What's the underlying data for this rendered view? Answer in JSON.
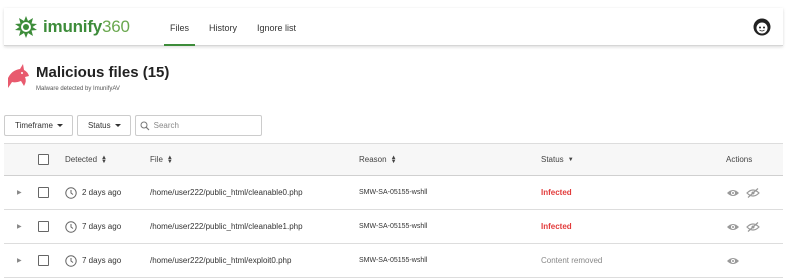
{
  "app": {
    "brand_name": "imunify",
    "brand_number": "360",
    "brand_color": "#3d8c3a"
  },
  "nav": {
    "tabs": [
      {
        "label": "Files",
        "active": true
      },
      {
        "label": "History"
      },
      {
        "label": "Ignore list"
      }
    ]
  },
  "page": {
    "title": "Malicious files (15)",
    "subtitle": "Malware detected by ImunifyAV"
  },
  "filters": {
    "timeframe_label": "Timeframe",
    "status_label": "Status",
    "search_placeholder": "Search"
  },
  "table": {
    "columns": {
      "detected": "Detected",
      "file": "File",
      "reason": "Reason",
      "status": "Status",
      "actions": "Actions"
    },
    "rows": [
      {
        "detected": "2 days ago",
        "file": "/home/user222/public_html/cleanable0.php",
        "reason": "SMW-SA-05155-wshll",
        "status": "Infected"
      },
      {
        "detected": "7 days ago",
        "file": "/home/user222/public_html/cleanable1.php",
        "reason": "SMW-SA-05155-wshll",
        "status": "Infected"
      },
      {
        "detected": "7 days ago",
        "file": "/home/user222/public_html/exploit0.php",
        "reason": "SMW-SA-05155-wshll",
        "status": "Content removed"
      }
    ]
  },
  "colors": {
    "infected": "#e23b3b",
    "removed": "#888888",
    "accent": "#3d8c3a",
    "shark": "#e85a6e"
  }
}
